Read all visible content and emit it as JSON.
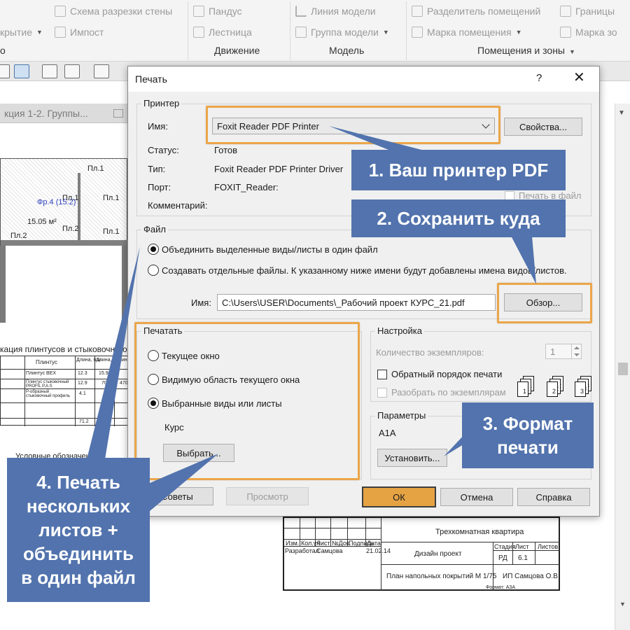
{
  "ribbon": {
    "row1": {
      "wall_sweep": "Схема разрезки стены",
      "ramp": "Пандус",
      "model_line": "Линия  модели",
      "room_separator": "Разделитель помещений",
      "area_boundary": "Границы"
    },
    "row2": {
      "opening_partial": "крытие",
      "mullion": "Импост",
      "stair": "Лестница",
      "model_group": "Группа модели",
      "room_tag": "Марка помещения",
      "area_tag": "Марка  зо"
    },
    "panels": {
      "partial": "о",
      "circulation": "Движение",
      "model": "Модель",
      "room_area": "Помещения и зоны"
    }
  },
  "view": {
    "tab_title": "кция 1-2. Группы...",
    "table_title": "кация плинтусов и стыковочного пр",
    "table_head": [
      "Плинтус",
      "Длина, п.м.",
      "Длина, п.м.",
      "Длина"
    ],
    "table_rows": [
      [
        "Плинтус ВЕХ",
        "12.3",
        "15.9"
      ],
      [
        "Плинтус стыковочный PROFIL P.A.S",
        "12.9",
        "70",
        "470"
      ],
      [
        "Р-образный стыковочный профиль",
        "4.1",
        ""
      ],
      [
        "",
        "71.2",
        ""
      ]
    ],
    "legend_label": "Условные обозначения",
    "plan_tags": [
      "Фр.4 (15.2)",
      "15.05 м²",
      "Пл.2",
      "Пл.1",
      "Пл.1",
      "Пл.2",
      "Пл.1",
      "Пл.1"
    ],
    "stamp": {
      "project": "Трехкомнатная квартира",
      "stage_design": "Дизайн проект",
      "sheet_name": "План напольных покрытий М 1/75",
      "stage_label": "Стадия",
      "sheet_label": "Лист",
      "sheets_label": "Листов",
      "stage": "РД",
      "sheet": "6.1",
      "author": "ИП Самцова О.В.",
      "row_head": [
        "Изм.",
        "Кол.уч",
        "Лист",
        "№Док.",
        "Подпись",
        "Дата"
      ],
      "developer_label": "Разработал",
      "developer": "Самцова",
      "date": "21.02.14",
      "format": "Формат: А3А"
    }
  },
  "dialog": {
    "title": "Печать",
    "help": "?",
    "close": "✕",
    "printer": {
      "legend": "Принтер",
      "name_label": "Имя:",
      "name_value": "Foxit Reader PDF Printer",
      "properties_btn": "Свойства...",
      "status_label": "Статус:",
      "status_value": "Готов",
      "type_label": "Тип:",
      "type_value": "Foxit Reader PDF Printer Driver",
      "port_label": "Порт:",
      "port_value": "FOXIT_Reader:",
      "comment_label": "Комментарий:",
      "print_to_file": "Печать в файл"
    },
    "file": {
      "legend": "Файл",
      "combine_option": "Объединить выделенные виды/листы в один файл",
      "separate_option": "Создавать отдельные файлы. К указанному ниже имени будут добавлены имена видов/листов.",
      "name_label": "Имя:",
      "name_value": "C:\\Users\\USER\\Documents\\_Рабочий проект КУРС_21.pdf",
      "browse_btn": "Обзор..."
    },
    "print_range": {
      "legend": "Печатать",
      "current_window": "Текущее окно",
      "visible_portion": "Видимую область текущего окна",
      "selected_views": "Выбранные виды или листы",
      "set_name": "Курс",
      "select_btn": "Выбрать..."
    },
    "options": {
      "legend": "Настройка",
      "copies_label": "Количество экземпляров:",
      "copies_value": "1",
      "reverse_order": "Обратный порядок печати",
      "collate": "Разобрать по экземплярам"
    },
    "settings": {
      "legend": "Параметры",
      "value": "A1A",
      "setup_btn": "Установить..."
    },
    "buttons": {
      "tips": "Советы",
      "preview": "Просмотр",
      "ok": "ОК",
      "cancel": "Отмена",
      "help": "Справка"
    }
  },
  "callouts": {
    "c1": "1. Ваш принтер PDF",
    "c2": "2. Сохранить куда",
    "c3": "3. Формат\nпечати",
    "c4": "4. Печать\nнескольких\nлистов +\nобъединить\nв один файл"
  },
  "colors": {
    "callout_bg": "#5273ad",
    "highlight": "#eba64a",
    "ok_button": "#e5a344"
  }
}
